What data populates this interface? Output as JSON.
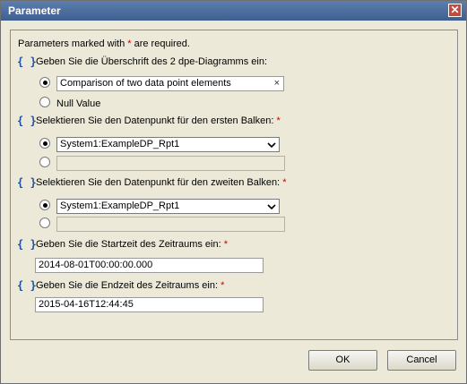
{
  "dialog": {
    "title": "Parameter",
    "close_glyph": "✕",
    "required_note_prefix": "Parameters marked with ",
    "required_note_star": "*",
    "required_note_suffix": " are required."
  },
  "params": {
    "heading": {
      "label": "Geben Sie die Überschrift des 2 dpe-Diagramms ein:",
      "value": "Comparison of two data point elements",
      "clear_glyph": "×",
      "null_option": "Null Value"
    },
    "first_dp": {
      "label": "Selektieren Sie den Datenpunkt für den ersten Balken:",
      "required": "*",
      "selected": "System1:ExampleDP_Rpt1",
      "alt_value": ""
    },
    "second_dp": {
      "label": "Selektieren Sie den Datenpunkt für den zweiten Balken:",
      "required": "*",
      "selected": "System1:ExampleDP_Rpt1",
      "alt_value": ""
    },
    "start_time": {
      "label": "Geben Sie die Startzeit des Zeitraums ein:",
      "required": "*",
      "value": "2014-08-01T00:00:00.000"
    },
    "end_time": {
      "label": "Geben Sie die Endzeit des Zeitraums ein:",
      "required": "*",
      "value": "2015-04-16T12:44:45"
    }
  },
  "icons": {
    "param": "{ }"
  },
  "buttons": {
    "ok": "OK",
    "cancel": "Cancel"
  }
}
